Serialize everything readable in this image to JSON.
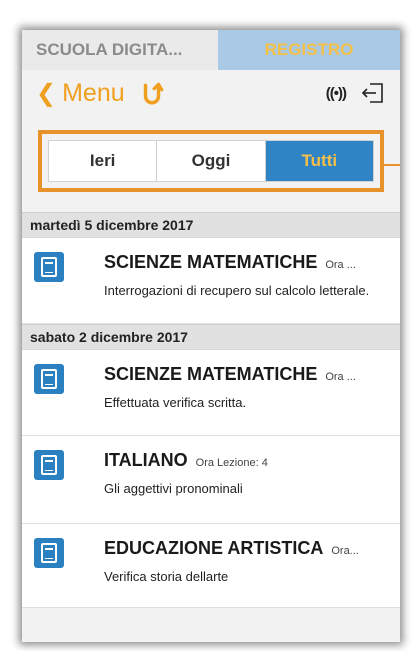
{
  "top_tabs": {
    "school": "SCUOLA DIGITA...",
    "registro": "REGISTRO"
  },
  "header": {
    "back_label": "Menu",
    "signal_glyph": "((•))"
  },
  "filter": {
    "options": [
      "Ieri",
      "Oggi",
      "Tutti"
    ],
    "selected": "Tutti"
  },
  "groups": [
    {
      "date": "martedì 5 dicembre 2017",
      "entries": [
        {
          "subject": "SCIENZE MATEMATICHE",
          "ora": "Ora ...",
          "description": "Interrogazioni di recupero sul calcolo letterale."
        }
      ]
    },
    {
      "date": "sabato 2 dicembre 2017",
      "entries": [
        {
          "subject": "SCIENZE MATEMATICHE",
          "ora": "Ora ...",
          "description": "Effettuata verifica scritta."
        },
        {
          "subject": "ITALIANO",
          "ora": "Ora Lezione: 4",
          "description": "Gli aggettivi pronominali"
        },
        {
          "subject": "EDUCAZIONE ARTISTICA",
          "ora": "Ora...",
          "description": "Verifica storia dellarte"
        }
      ]
    }
  ],
  "colors": {
    "accent_orange": "#f0a020",
    "selected_blue": "#2f84c6",
    "icon_blue": "#2a80c0",
    "highlight_border": "#e7922b"
  }
}
